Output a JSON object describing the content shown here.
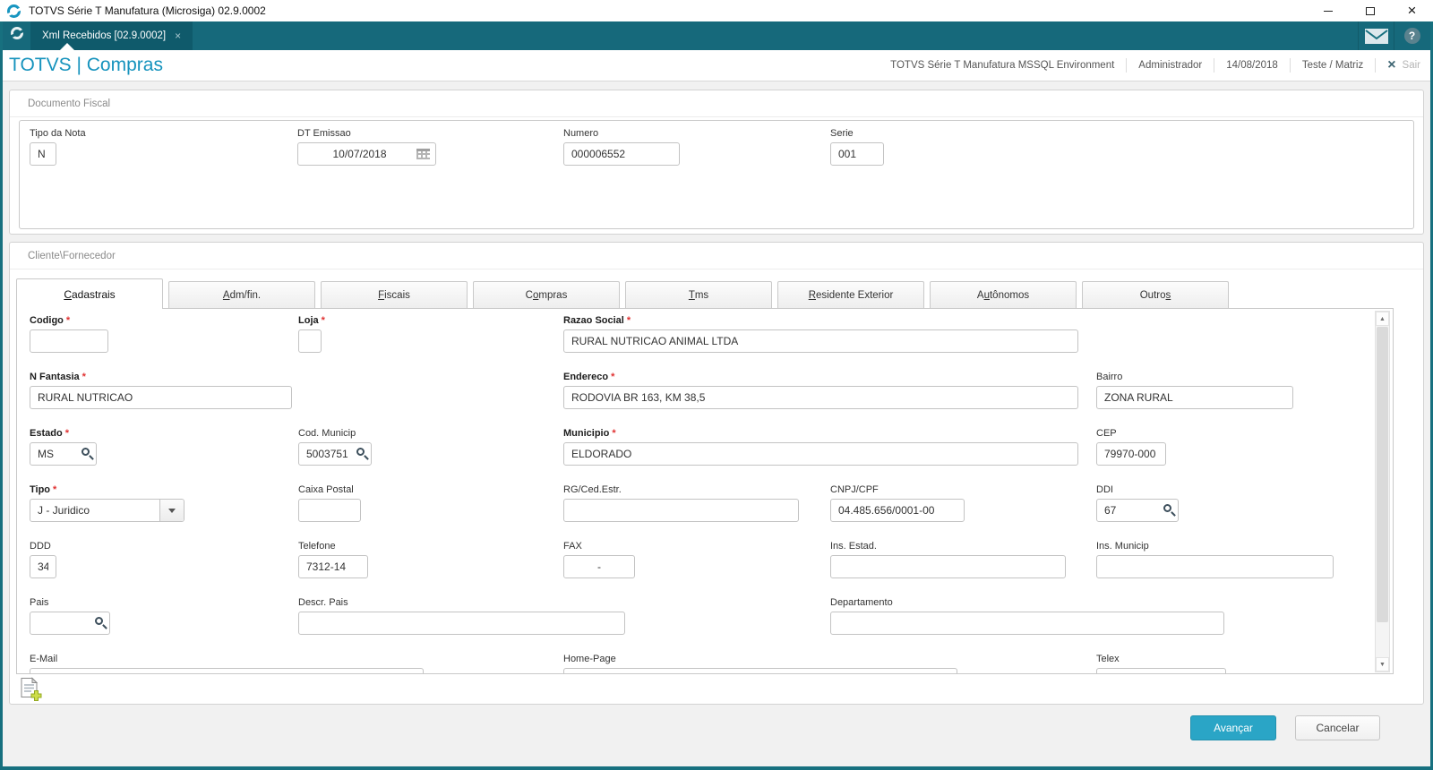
{
  "window": {
    "title": "TOTVS Série T Manufatura (Microsiga) 02.9.0002",
    "app_icon": "totvs-logo-icon",
    "control_icons": [
      "minimize-icon",
      "maximize-icon",
      "close-icon"
    ]
  },
  "workspace_tabs": {
    "logo_icon": "totvs-ring-icon",
    "active_tab": {
      "label": "Xml Recebidos [02.9.0002]",
      "close_glyph": "×"
    },
    "right_icons": [
      "mail-icon",
      "help-icon"
    ]
  },
  "header": {
    "title": "TOTVS | Compras",
    "environment": "TOTVS Série T Manufatura MSSQL Environment",
    "user": "Administrador",
    "date": "14/08/2018",
    "branch": "Teste / Matriz",
    "exit_label": "Sair"
  },
  "documento_fiscal": {
    "title": "Documento Fiscal",
    "fields": [
      {
        "id": "tipo_da_nota",
        "label": "Tipo da Nota",
        "value": "N"
      },
      {
        "id": "dt_emissao",
        "label": "DT Emissao",
        "value": "10/07/2018",
        "icon": "calendar"
      },
      {
        "id": "numero",
        "label": "Numero",
        "value": "000006552"
      },
      {
        "id": "serie",
        "label": "Serie",
        "value": "001"
      }
    ]
  },
  "cliente_fornecedor": {
    "title": "Cliente\\Fornecedor",
    "tabs": [
      {
        "label": "Cadastrais",
        "accel_index": 0,
        "active": true
      },
      {
        "label": "Adm/fin.",
        "accel_index": 0,
        "active": false
      },
      {
        "label": "Fiscais",
        "accel_index": 0,
        "active": false
      },
      {
        "label": "Compras",
        "accel_index": 1,
        "active": false
      },
      {
        "label": "Tms",
        "accel_index": 0,
        "active": false
      },
      {
        "label": "Residente Exterior",
        "accel_index": 0,
        "active": false
      },
      {
        "label": "Autônomos",
        "accel_index": 1,
        "active": false
      },
      {
        "label": "Outros",
        "accel_index": 5,
        "active": false
      }
    ],
    "fields": [
      {
        "id": "codigo",
        "label": "Codigo",
        "required": true,
        "value": ""
      },
      {
        "id": "loja",
        "label": "Loja",
        "required": true,
        "value": ""
      },
      {
        "id": "razao_social",
        "label": "Razao Social",
        "required": true,
        "value": "RURAL NUTRICAO ANIMAL LTDA"
      },
      {
        "id": "n_fantasia",
        "label": "N Fantasia",
        "required": true,
        "value": "RURAL NUTRICAO"
      },
      {
        "id": "endereco",
        "label": "Endereco",
        "required": true,
        "value": "RODOVIA BR 163, KM 38,5"
      },
      {
        "id": "bairro",
        "label": "Bairro",
        "value": "ZONA RURAL"
      },
      {
        "id": "estado",
        "label": "Estado",
        "required": true,
        "value": "MS",
        "icon": "search"
      },
      {
        "id": "cod_municip",
        "label": "Cod. Municip",
        "value": "5003751",
        "icon": "search"
      },
      {
        "id": "municipio",
        "label": "Municipio",
        "required": true,
        "value": "ELDORADO"
      },
      {
        "id": "cep",
        "label": "CEP",
        "value": "79970-000"
      },
      {
        "id": "tipo",
        "label": "Tipo",
        "required": true,
        "value": "J - Juridico",
        "icon": "dropdown"
      },
      {
        "id": "caixa_postal",
        "label": "Caixa Postal",
        "value": ""
      },
      {
        "id": "rg_ced_estr",
        "label": "RG/Ced.Estr.",
        "value": ""
      },
      {
        "id": "cnpj_cpf",
        "label": "CNPJ/CPF",
        "value": "04.485.656/0001-00"
      },
      {
        "id": "ddi",
        "label": "DDI",
        "value": "67",
        "icon": "search"
      },
      {
        "id": "ddd",
        "label": "DDD",
        "value": "34"
      },
      {
        "id": "telefone",
        "label": "Telefone",
        "value": "7312-14"
      },
      {
        "id": "fax",
        "label": "FAX",
        "value": "-"
      },
      {
        "id": "ins_estad",
        "label": "Ins. Estad.",
        "value": ""
      },
      {
        "id": "ins_municip",
        "label": "Ins. Municip",
        "value": ""
      },
      {
        "id": "pais",
        "label": "Pais",
        "value": "",
        "icon": "search"
      },
      {
        "id": "descr_pais",
        "label": "Descr. Pais",
        "value": ""
      },
      {
        "id": "departamento",
        "label": "Departamento",
        "value": ""
      },
      {
        "id": "e_mail",
        "label": "E-Mail",
        "value": ""
      },
      {
        "id": "home_page",
        "label": "Home-Page",
        "value": ""
      },
      {
        "id": "telex",
        "label": "Telex",
        "value": ""
      }
    ]
  },
  "actions": {
    "add_document_icon": "add-document-icon",
    "advance_label": "Avançar",
    "cancel_label": "Cancelar"
  }
}
